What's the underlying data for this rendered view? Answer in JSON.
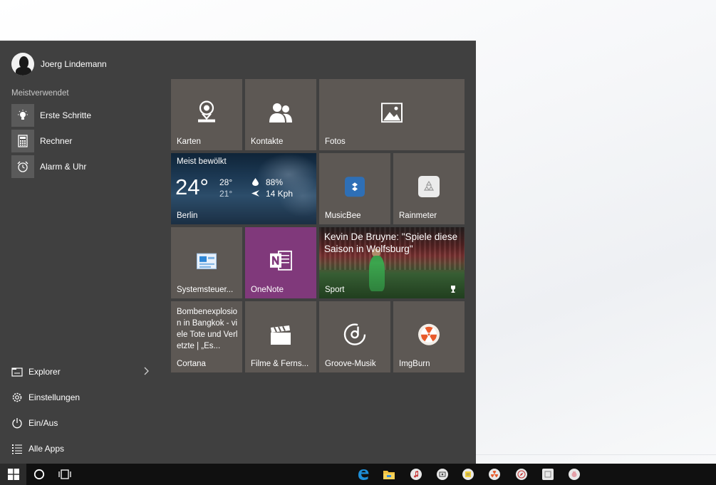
{
  "user": {
    "name": "Joerg Lindemann"
  },
  "most_used": {
    "label": "Meistverwendet",
    "items": [
      {
        "label": "Erste Schritte",
        "icon": "lightbulb-icon"
      },
      {
        "label": "Rechner",
        "icon": "calculator-icon"
      },
      {
        "label": "Alarm & Uhr",
        "icon": "alarm-clock-icon"
      }
    ]
  },
  "bottom_items": [
    {
      "label": "Explorer",
      "icon": "file-explorer-icon"
    },
    {
      "label": "Einstellungen",
      "icon": "gear-icon"
    },
    {
      "label": "Ein/Aus",
      "icon": "power-icon"
    },
    {
      "label": "Alle Apps",
      "icon": "list-icon"
    }
  ],
  "tiles": {
    "karten": "Karten",
    "kontakte": "Kontakte",
    "fotos": "Fotos",
    "weather": {
      "condition": "Meist bewölkt",
      "temp": "24°",
      "high": "28°",
      "low": "21°",
      "humidity": "88%",
      "wind": "14 Kph",
      "city": "Berlin"
    },
    "musicbee": "MusicBee",
    "rainmeter": "Rainmeter",
    "systemsteuerung": "Systemsteuer...",
    "onenote": "OneNote",
    "sport": {
      "headline": "Kevin De Bruyne: \"Spiele diese Saison in Wolfsburg\"",
      "label": "Sport"
    },
    "cortana": {
      "news": "Bombenexplosion in Bangkok - viele Tote und Verletzte | „Es...",
      "label": "Cortana"
    },
    "filme": "Filme & Ferns...",
    "groove": "Groove-Musik",
    "imgburn": "ImgBurn"
  },
  "colors": {
    "menu_bg": "#404040",
    "tile_bg": "#5d5854",
    "onenote": "#80397b",
    "taskbar": "#101010",
    "accent": "#1e8fd8"
  }
}
